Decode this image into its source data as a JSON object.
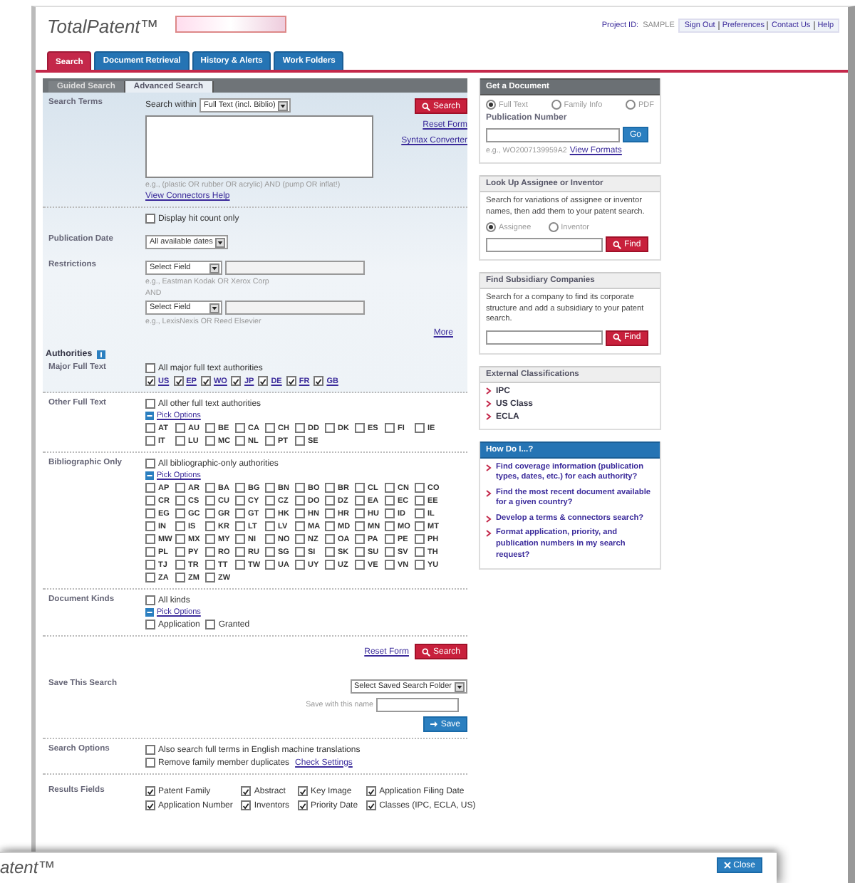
{
  "header": {
    "logo": "TotalPatent™",
    "project_label": "Project ID:",
    "project_id": "SAMPLE",
    "links": [
      "Sign Out",
      "Preferences",
      "Contact Us",
      "Help"
    ]
  },
  "tabs": [
    {
      "label": "Search",
      "selected": true
    },
    {
      "label": "Document Retrieval",
      "selected": false
    },
    {
      "label": "History & Alerts",
      "selected": false
    },
    {
      "label": "Work Folders",
      "selected": false
    }
  ],
  "subtabs": [
    {
      "label": "Guided Search",
      "selected": false
    },
    {
      "label": "Advanced Search",
      "selected": true
    }
  ],
  "search_terms": {
    "label": "Search Terms",
    "within_label": "Search within",
    "within_value": "Full Text (incl. Biblio)",
    "example": "e.g., (plastic OR rubber OR acrylic) AND (pump OR inflat!)",
    "help_link": "View Connectors Help",
    "search_button": "Search",
    "reset_link": "Reset Form",
    "syntax_link": "Syntax Converter"
  },
  "hit_count": {
    "label": "Display hit count only",
    "checked": false
  },
  "publication_date": {
    "label": "Publication Date",
    "value": "All available dates"
  },
  "restrictions": {
    "label": "Restrictions",
    "connector": "AND",
    "more_link": "More",
    "fields": [
      {
        "value": "Select Field",
        "example": "e.g., Eastman Kodak OR Xerox Corp"
      },
      {
        "value": "Select Field",
        "example": "e.g., LexisNexis OR Reed Elsevier"
      }
    ]
  },
  "authorities": {
    "heading": "Authorities",
    "groups": [
      {
        "label": "Major Full Text",
        "kind": "linked",
        "all": {
          "label": "All major full text authorities",
          "checked": false
        },
        "items": [
          {
            "code": "US",
            "checked": true
          },
          {
            "code": "EP",
            "checked": true
          },
          {
            "code": "WO",
            "checked": true
          },
          {
            "code": "JP",
            "checked": true
          },
          {
            "code": "DE",
            "checked": true
          },
          {
            "code": "FR",
            "checked": true
          },
          {
            "code": "GB",
            "checked": true
          }
        ]
      },
      {
        "label": "Other Full Text",
        "kind": "plain",
        "all": {
          "label": "All other full text authorities",
          "checked": false
        },
        "pick_options": "Pick Options",
        "items": [
          {
            "code": "AT",
            "checked": false
          },
          {
            "code": "AU",
            "checked": false
          },
          {
            "code": "BE",
            "checked": false
          },
          {
            "code": "CA",
            "checked": false
          },
          {
            "code": "CH",
            "checked": false
          },
          {
            "code": "DD",
            "checked": false
          },
          {
            "code": "DK",
            "checked": false
          },
          {
            "code": "ES",
            "checked": false
          },
          {
            "code": "FI",
            "checked": false
          },
          {
            "code": "IE",
            "checked": false
          },
          {
            "code": "IT",
            "checked": false
          },
          {
            "code": "LU",
            "checked": false
          },
          {
            "code": "MC",
            "checked": false
          },
          {
            "code": "NL",
            "checked": false
          },
          {
            "code": "PT",
            "checked": false
          },
          {
            "code": "SE",
            "checked": false
          }
        ]
      },
      {
        "label": "Bibliographic Only",
        "kind": "plain",
        "all": {
          "label": "All bibliographic-only authorities",
          "checked": false
        },
        "pick_options": "Pick Options",
        "items": [
          {
            "code": "AP",
            "checked": false
          },
          {
            "code": "AR",
            "checked": false
          },
          {
            "code": "BA",
            "checked": false
          },
          {
            "code": "BG",
            "checked": false
          },
          {
            "code": "BN",
            "checked": false
          },
          {
            "code": "BO",
            "checked": false
          },
          {
            "code": "BR",
            "checked": false
          },
          {
            "code": "CL",
            "checked": false
          },
          {
            "code": "CN",
            "checked": false
          },
          {
            "code": "CO",
            "checked": false
          },
          {
            "code": "CR",
            "checked": false
          },
          {
            "code": "CS",
            "checked": false
          },
          {
            "code": "CU",
            "checked": false
          },
          {
            "code": "CY",
            "checked": false
          },
          {
            "code": "CZ",
            "checked": false
          },
          {
            "code": "DO",
            "checked": false
          },
          {
            "code": "DZ",
            "checked": false
          },
          {
            "code": "EA",
            "checked": false
          },
          {
            "code": "EC",
            "checked": false
          },
          {
            "code": "EE",
            "checked": false
          },
          {
            "code": "EG",
            "checked": false
          },
          {
            "code": "GC",
            "checked": false
          },
          {
            "code": "GR",
            "checked": false
          },
          {
            "code": "GT",
            "checked": false
          },
          {
            "code": "HK",
            "checked": false
          },
          {
            "code": "HN",
            "checked": false
          },
          {
            "code": "HR",
            "checked": false
          },
          {
            "code": "HU",
            "checked": false
          },
          {
            "code": "ID",
            "checked": false
          },
          {
            "code": "IL",
            "checked": false
          },
          {
            "code": "IN",
            "checked": false
          },
          {
            "code": "IS",
            "checked": false
          },
          {
            "code": "KR",
            "checked": false
          },
          {
            "code": "LT",
            "checked": false
          },
          {
            "code": "LV",
            "checked": false
          },
          {
            "code": "MA",
            "checked": false
          },
          {
            "code": "MD",
            "checked": false
          },
          {
            "code": "MN",
            "checked": false
          },
          {
            "code": "MO",
            "checked": false
          },
          {
            "code": "MT",
            "checked": false
          },
          {
            "code": "MW",
            "checked": false
          },
          {
            "code": "MX",
            "checked": false
          },
          {
            "code": "MY",
            "checked": false
          },
          {
            "code": "NI",
            "checked": false
          },
          {
            "code": "NO",
            "checked": false
          },
          {
            "code": "NZ",
            "checked": false
          },
          {
            "code": "OA",
            "checked": false
          },
          {
            "code": "PA",
            "checked": false
          },
          {
            "code": "PE",
            "checked": false
          },
          {
            "code": "PH",
            "checked": false
          },
          {
            "code": "PL",
            "checked": false
          },
          {
            "code": "PY",
            "checked": false
          },
          {
            "code": "RO",
            "checked": false
          },
          {
            "code": "RU",
            "checked": false
          },
          {
            "code": "SG",
            "checked": false
          },
          {
            "code": "SI",
            "checked": false
          },
          {
            "code": "SK",
            "checked": false
          },
          {
            "code": "SU",
            "checked": false
          },
          {
            "code": "SV",
            "checked": false
          },
          {
            "code": "TH",
            "checked": false
          },
          {
            "code": "TJ",
            "checked": false
          },
          {
            "code": "TR",
            "checked": false
          },
          {
            "code": "TT",
            "checked": false
          },
          {
            "code": "TW",
            "checked": false
          },
          {
            "code": "UA",
            "checked": false
          },
          {
            "code": "UY",
            "checked": false
          },
          {
            "code": "UZ",
            "checked": false
          },
          {
            "code": "VE",
            "checked": false
          },
          {
            "code": "VN",
            "checked": false
          },
          {
            "code": "YU",
            "checked": false
          },
          {
            "code": "ZA",
            "checked": false
          },
          {
            "code": "ZM",
            "checked": false
          },
          {
            "code": "ZW",
            "checked": false
          }
        ]
      }
    ]
  },
  "document_kinds": {
    "label": "Document Kinds",
    "all": {
      "label": "All kinds",
      "checked": false
    },
    "pick_options": "Pick Options",
    "items": [
      {
        "label": "Application",
        "checked": false
      },
      {
        "label": "Granted",
        "checked": false
      }
    ]
  },
  "search_actions": {
    "reset_link": "Reset Form",
    "search_button": "Search"
  },
  "save_search": {
    "label": "Save This Search",
    "folder_value": "Select Saved Search Folder",
    "name_label": "Save with this name",
    "save_button": "Save"
  },
  "search_options": {
    "label": "Search Options",
    "options": [
      {
        "label": "Also search full terms in English machine translations",
        "checked": false
      },
      {
        "label": "Remove family member duplicates",
        "checked": false,
        "link": "Check Settings"
      }
    ]
  },
  "results_fields": {
    "label": "Results Fields",
    "fields": [
      {
        "label": "Patent Family",
        "checked": true
      },
      {
        "label": "Abstract",
        "checked": true
      },
      {
        "label": "Key Image",
        "checked": true
      },
      {
        "label": "Application Filing Date",
        "checked": true
      },
      {
        "label": "Application Number",
        "checked": true
      },
      {
        "label": "Inventors",
        "checked": true
      },
      {
        "label": "Priority Date",
        "checked": true
      },
      {
        "label": "Classes (IPC, ECLA, US)",
        "checked": true
      }
    ]
  },
  "sidebar": {
    "get_document": {
      "title": "Get a Document",
      "options": [
        {
          "label": "Full Text",
          "selected": true
        },
        {
          "label": "Family Info",
          "selected": false
        },
        {
          "label": "PDF",
          "selected": false
        }
      ],
      "number_label": "Publication Number",
      "go_button": "Go",
      "example": "e.g., WO2007139959A2",
      "formats_link": "View Formats"
    },
    "lookup": {
      "title": "Look Up Assignee or Inventor",
      "text": "Search for variations of assignee or inventor names, then add them to your patent search.",
      "options": [
        {
          "label": "Assignee",
          "selected": true
        },
        {
          "label": "Inventor",
          "selected": false
        }
      ],
      "find_button": "Find"
    },
    "subsidiary": {
      "title": "Find Subsidiary Companies",
      "text": "Search for a company to find its corporate structure and add a subsidiary to your patent search.",
      "find_button": "Find"
    },
    "classifications": {
      "title": "External Classifications",
      "items": [
        "IPC",
        "US Class",
        "ECLA"
      ]
    },
    "how_do_i": {
      "title": "How Do I...?",
      "items": [
        "Find coverage information (publication types, dates, etc.) for each authority?",
        "Find the most recent document available for a given country?",
        "Develop a terms & connectors search?",
        "Format application, priority, and publication numbers in my search request?"
      ]
    }
  },
  "bottom_window": {
    "title": "atent™",
    "close_button": "Close"
  }
}
